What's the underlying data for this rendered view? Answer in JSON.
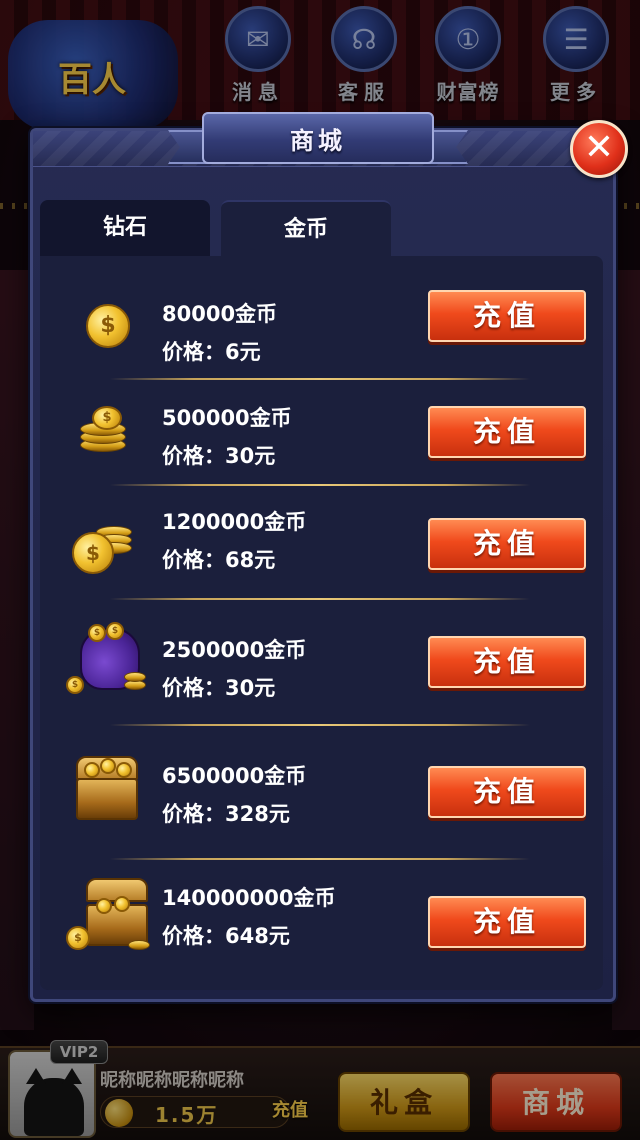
{
  "background": {
    "logo_text": "百人",
    "top_nav": [
      {
        "label": "消息",
        "icon": "mail-icon"
      },
      {
        "label": "客服",
        "icon": "headset-icon"
      },
      {
        "label": "财富榜",
        "icon": "medal-icon"
      },
      {
        "label": "更多",
        "icon": "list-icon"
      }
    ]
  },
  "shop": {
    "title": "商城",
    "close_symbol": "✕",
    "tabs": [
      {
        "label": "钻石"
      },
      {
        "label": "金币"
      }
    ],
    "items": [
      {
        "amount": "80000金币",
        "price": "价格：6元",
        "button": "充值",
        "icon": "single-coin-icon"
      },
      {
        "amount": "500000金币",
        "price": "价格：30元",
        "button": "充值",
        "icon": "coin-stack-icon"
      },
      {
        "amount": "1200000金币",
        "price": "价格：68元",
        "button": "充值",
        "icon": "coin-pile-icon"
      },
      {
        "amount": "2500000金币",
        "price": "价格：30元",
        "button": "充值",
        "icon": "coin-bag-icon"
      },
      {
        "amount": "6500000金币",
        "price": "价格：328元",
        "button": "充值",
        "icon": "treasure-chest-icon"
      },
      {
        "amount": "140000000金币",
        "price": "价格：648元",
        "button": "充值",
        "icon": "open-treasure-chest-icon"
      }
    ]
  },
  "player": {
    "vip": "VIP2",
    "nickname": "昵称昵称昵称昵称",
    "coins": "1.5万",
    "recharge_label": "充值"
  },
  "bottom_bar": {
    "gift_label": "礼盒",
    "shop_label": "商城"
  }
}
